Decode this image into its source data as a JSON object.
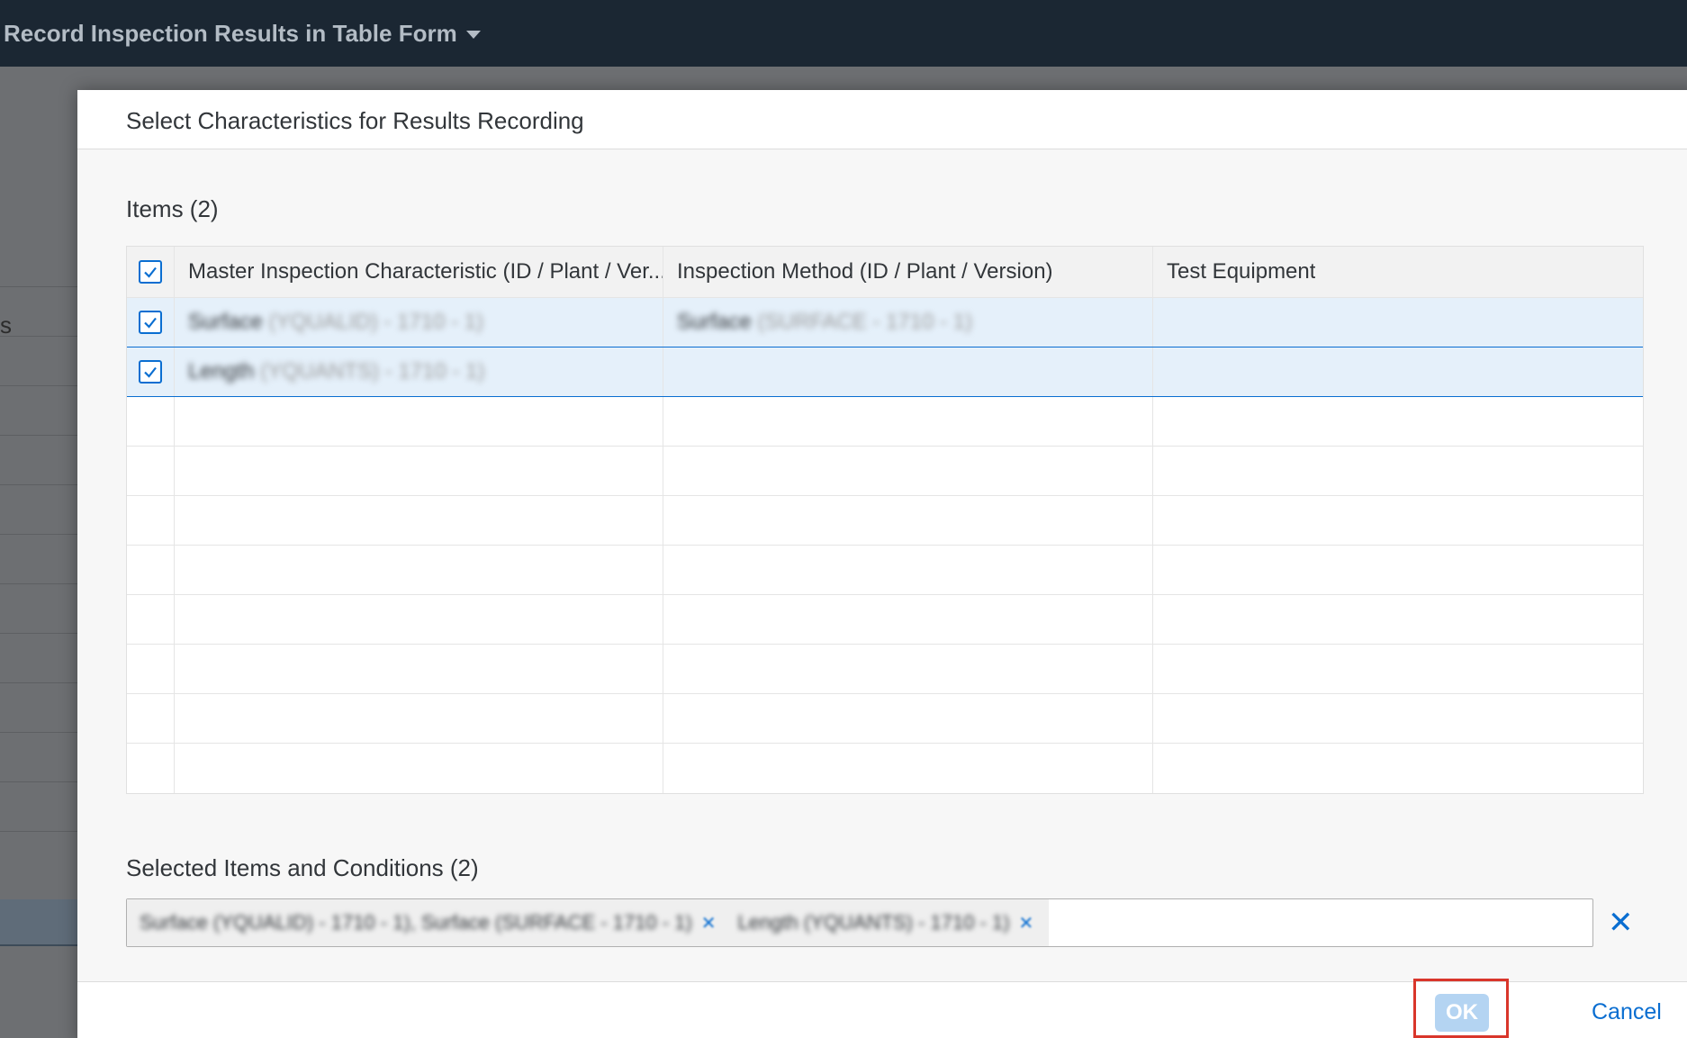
{
  "shell": {
    "app_title": "Record Inspection Results in Table Form"
  },
  "background": {
    "partial_label": "s"
  },
  "dialog": {
    "title": "Select Characteristics for Results Recording",
    "items_title": "Items (2)",
    "columns": [
      "Master Inspection Characteristic (ID / Plant / Ver...",
      "Inspection Method (ID / Plant / Version)",
      "Test Equipment"
    ],
    "rows": [
      {
        "mic_name": "Surface",
        "mic_meta": "(YQUALID) - 1710 - 1)",
        "method_name": "Surface",
        "method_meta": "(SURFACE - 1710 - 1)",
        "equipment": "",
        "selected": true
      },
      {
        "mic_name": "Length",
        "mic_meta": "(YQUANTS) - 1710 - 1)",
        "method_name": "",
        "method_meta": "",
        "equipment": "",
        "selected": true
      }
    ],
    "selected_title": "Selected Items and Conditions (2)",
    "tokens": [
      {
        "text": "Surface (YQUALID) - 1710 - 1), Surface (SURFACE - 1710 - 1)"
      },
      {
        "text": "Length (YQUANTS) - 1710 - 1)"
      }
    ],
    "ok_label": "OK",
    "cancel_label": "Cancel"
  },
  "colors": {
    "accent": "#0a6ed1",
    "shell": "#1b2733",
    "highlight": "#d9362b"
  }
}
